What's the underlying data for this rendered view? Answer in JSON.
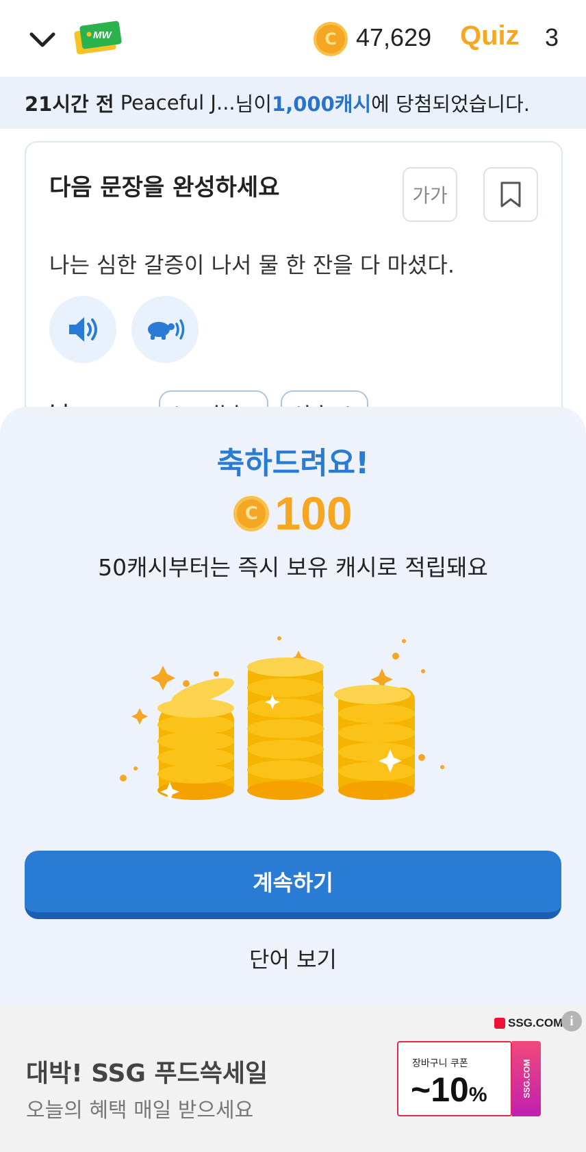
{
  "header": {
    "logo_text": "MW",
    "coin_symbol": "C",
    "coin_balance": "47,629",
    "quiz_logo": "Quiz",
    "quiz_count": "3"
  },
  "notice": {
    "time": "21시간 전",
    "user": "Peaceful J...",
    "mid": " 님이 ",
    "prize": "1,000캐시",
    "suffix": "에 당첨되었습니다."
  },
  "quiz_card": {
    "title": "다음 문장을 완성하세요",
    "font_size_label": "가가",
    "sentence": "나는 심한 갈증이 나서 물 한 잔을 다 마셨다.",
    "word_prefix": "I h...",
    "chips": [
      "terrible",
      "thirst"
    ],
    "word_suffix": "...",
    "icons": {
      "bookmark": "bookmark-icon",
      "audio_normal": "speaker-icon",
      "audio_slow": "turtle-speaker-icon"
    }
  },
  "reward_sheet": {
    "title": "축하드려요!",
    "coin_symbol": "C",
    "amount": "100",
    "description": "50캐시부터는 즉시 보유 캐시로 적립돼요",
    "continue_label": "계속하기",
    "words_label": "단어 보기"
  },
  "ad": {
    "brand": "SSG.COM",
    "info": "i",
    "title": "대박! SSG 푸드쓱세일",
    "subtitle": "오늘의 혜택 매일 받으세요",
    "coupon_label": "장바구니 쿠폰",
    "coupon_value": "~10",
    "coupon_unit": "%",
    "coupon_side": "SSG.COM"
  },
  "colors": {
    "accent_blue": "#2a7bd3",
    "coin_gold": "#f5a623",
    "notice_bg": "#eaf1fb",
    "sheet_bg": "#eef3fb"
  }
}
